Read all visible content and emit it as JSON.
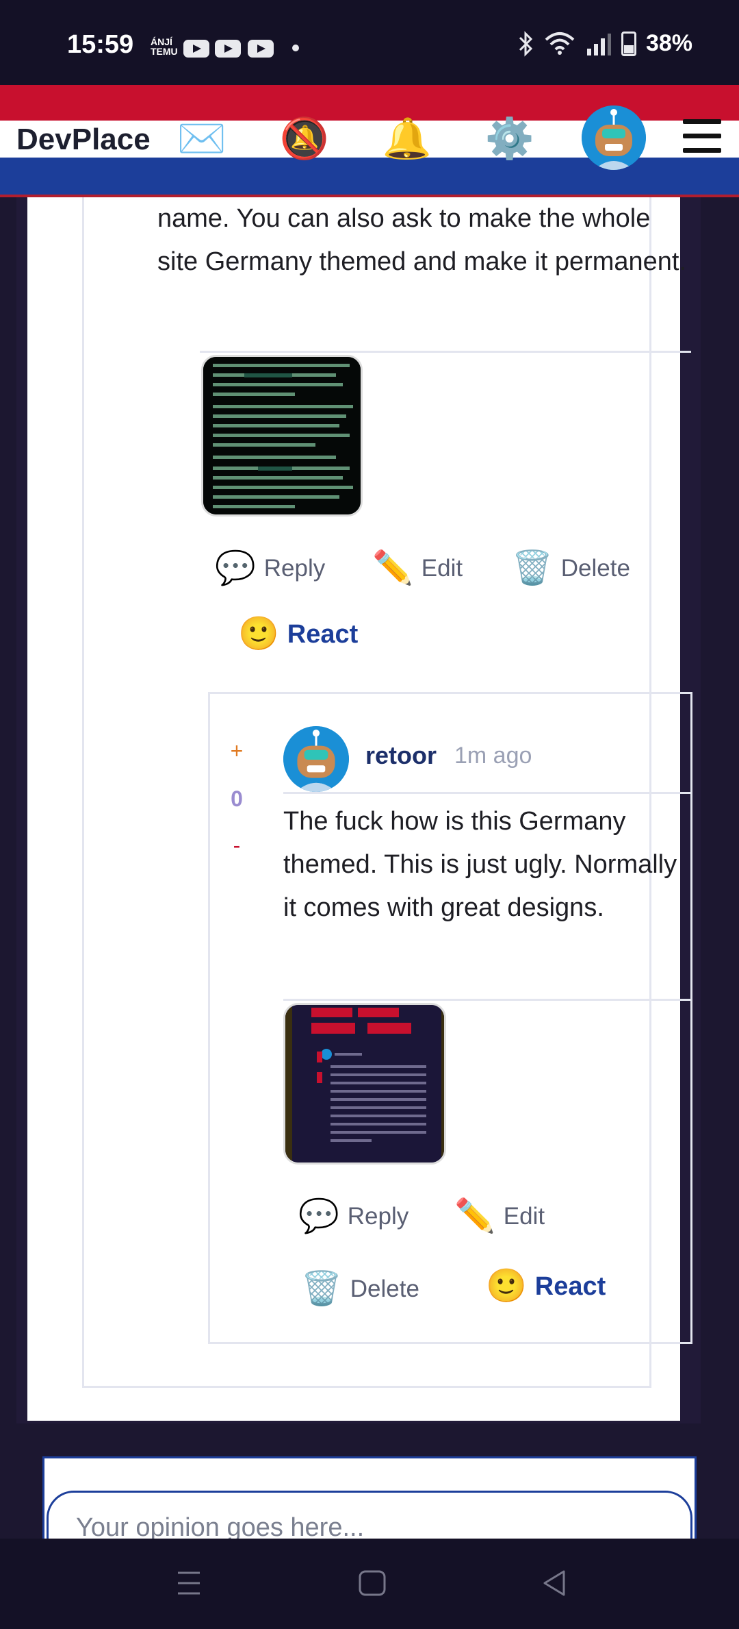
{
  "status_bar": {
    "time": "15:59",
    "carrier": "ÁNJÍ TEMU",
    "battery": "38%",
    "icons": [
      "youtube-icon",
      "youtube-icon",
      "youtube-icon",
      "bluetooth-icon",
      "wifi-icon",
      "signal-icon",
      "battery-icon"
    ]
  },
  "header": {
    "logo": "DevPlace",
    "icons": {
      "messages": "✉️",
      "mute": "🔕",
      "notifications": "🔔",
      "settings": "⚙️"
    },
    "colors": {
      "red": "#c8102e",
      "white": "#ffffff",
      "blue": "#1c3e9a"
    }
  },
  "comment": {
    "text": "name. You can also ask to make the whole site Germany themed and make it permanent.",
    "actions": {
      "reply": "Reply",
      "edit": "Edit",
      "delete": "Delete",
      "react": "React"
    }
  },
  "reply": {
    "votes": {
      "up": "+",
      "count": "0",
      "down": "-"
    },
    "author": "retoor",
    "time": "1m ago",
    "text": "The fuck how is this Germany themed. This is just ugly. Normally it comes with great designs.",
    "actions": {
      "reply": "Reply",
      "edit": "Edit",
      "delete": "Delete",
      "react": "React"
    }
  },
  "form": {
    "placeholder": "Your opinion goes here..."
  },
  "nav": {
    "icons": [
      "recent-apps-icon",
      "home-icon",
      "back-icon"
    ]
  }
}
